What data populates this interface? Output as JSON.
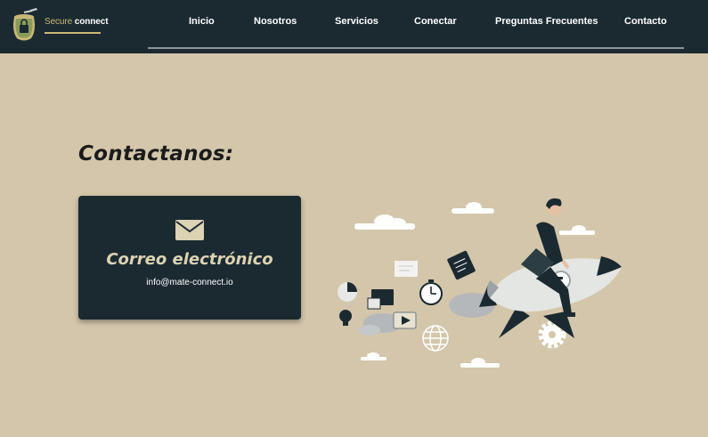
{
  "brand": {
    "name_part1": "Secure",
    "name_part2": "connect"
  },
  "nav": {
    "items": [
      {
        "label": "Inicio"
      },
      {
        "label": "Nosotros"
      },
      {
        "label": "Servicios"
      },
      {
        "label": "Conectar"
      },
      {
        "label": "Preguntas Frecuentes"
      },
      {
        "label": "Contacto"
      }
    ]
  },
  "main": {
    "title": "Contactanos:",
    "card": {
      "icon": "envelope-icon",
      "title": "Correo electrónico",
      "email": "info@mate-connect.io"
    }
  },
  "colors": {
    "navbar_bg": "#1b2a31",
    "page_bg": "#d3c6aa",
    "accent": "#c8b877",
    "card_title": "#dcd2b4"
  }
}
